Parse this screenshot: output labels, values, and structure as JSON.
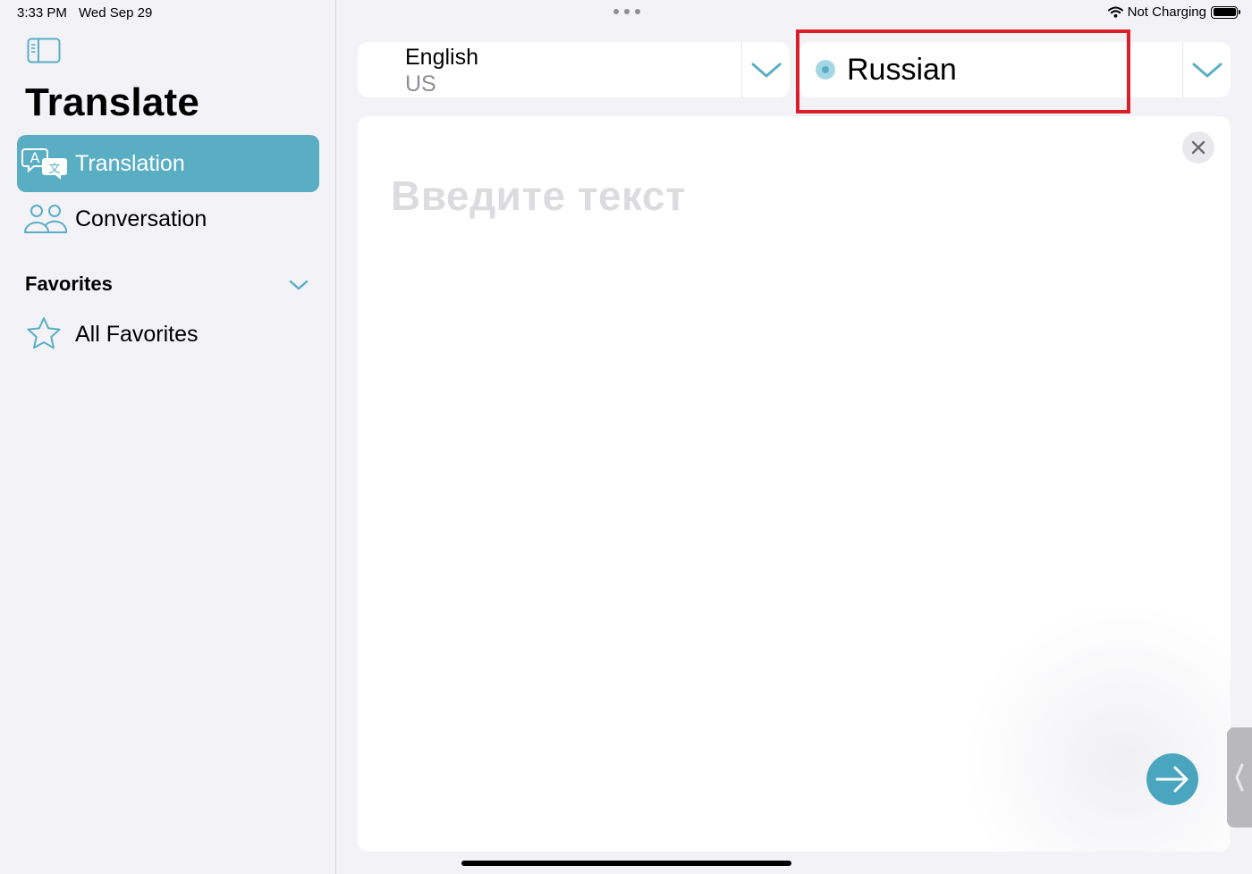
{
  "status_bar": {
    "time": "3:33 PM",
    "date": "Wed Sep 29",
    "charging": "Not Charging"
  },
  "sidebar": {
    "title": "Translate",
    "items": [
      {
        "label": "Translation",
        "icon": "translate-bubbles-icon",
        "active": true
      },
      {
        "label": "Conversation",
        "icon": "people-icon",
        "active": false
      }
    ],
    "favorites": {
      "header": "Favorites",
      "items": [
        {
          "label": "All Favorites",
          "icon": "star-icon"
        }
      ]
    }
  },
  "languages": {
    "source": {
      "name": "English",
      "region": "US"
    },
    "target": {
      "name": "Russian"
    }
  },
  "input": {
    "placeholder": "Введите текст"
  },
  "colors": {
    "accent": "#5aaec4",
    "highlight": "#dc1e28",
    "background": "#f2f2f7"
  }
}
